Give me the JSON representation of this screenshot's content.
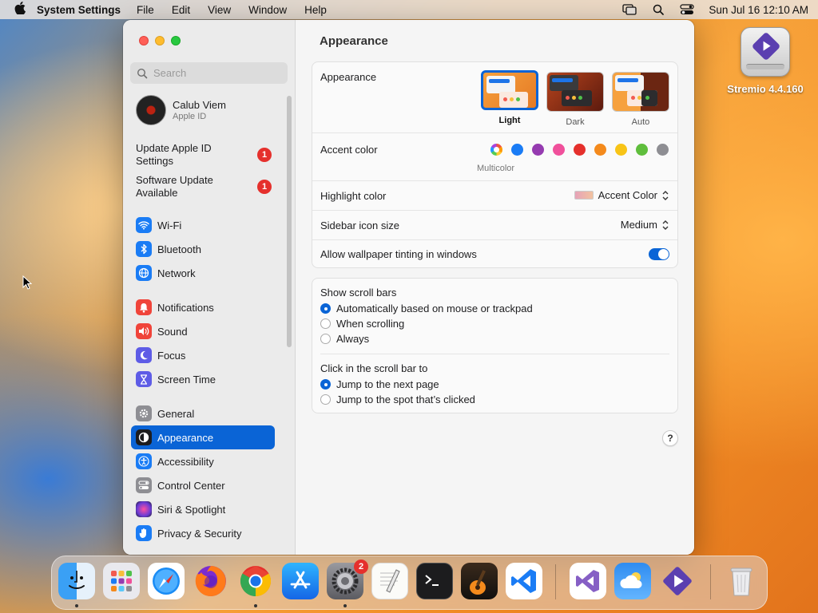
{
  "menubar": {
    "app_name": "System Settings",
    "menus": [
      "File",
      "Edit",
      "View",
      "Window",
      "Help"
    ],
    "datetime": "Sun Jul 16  12:10 AM"
  },
  "desktop": {
    "items": [
      {
        "label": "Stremio 4.4.160",
        "icon": "stremio-drive-icon"
      }
    ]
  },
  "window": {
    "sidebar": {
      "search_placeholder": "Search",
      "profile": {
        "name": "Calub Viem",
        "subtitle": "Apple ID"
      },
      "notices": [
        {
          "label": "Update Apple ID Settings",
          "badge": "1"
        },
        {
          "label": "Software Update Available",
          "badge": "1"
        }
      ],
      "groups": [
        [
          {
            "label": "Wi-Fi",
            "icon": "wifi-icon",
            "color": "#1a7cf5"
          },
          {
            "label": "Bluetooth",
            "icon": "bluetooth-icon",
            "color": "#1a7cf5"
          },
          {
            "label": "Network",
            "icon": "globe-icon",
            "color": "#1a7cf5"
          }
        ],
        [
          {
            "label": "Notifications",
            "icon": "bell-icon",
            "color": "#f0443a"
          },
          {
            "label": "Sound",
            "icon": "speaker-icon",
            "color": "#f0443a"
          },
          {
            "label": "Focus",
            "icon": "moon-icon",
            "color": "#5e5ce6"
          },
          {
            "label": "Screen Time",
            "icon": "hourglass-icon",
            "color": "#5e5ce6"
          }
        ],
        [
          {
            "label": "General",
            "icon": "gear-icon",
            "color": "#8e8e93"
          },
          {
            "label": "Appearance",
            "icon": "appearance-icon",
            "color": "#1c1c1e",
            "selected": true
          },
          {
            "label": "Accessibility",
            "icon": "accessibility-icon",
            "color": "#1a7cf5"
          },
          {
            "label": "Control Center",
            "icon": "control-center-icon",
            "color": "#8e8e93"
          },
          {
            "label": "Siri & Spotlight",
            "icon": "siri-icon",
            "color": "#b44ad6"
          },
          {
            "label": "Privacy & Security",
            "icon": "hand-icon",
            "color": "#1a7cf5"
          }
        ]
      ]
    },
    "main": {
      "title": "Appearance",
      "appearance": {
        "label": "Appearance",
        "options": [
          {
            "label": "Light",
            "selected": true
          },
          {
            "label": "Dark",
            "selected": false
          },
          {
            "label": "Auto",
            "selected": false
          }
        ]
      },
      "accent": {
        "label": "Accent color",
        "caption": "Multicolor",
        "colors": [
          "multicolor",
          "#1a7cf5",
          "#953bb0",
          "#f0509b",
          "#e5302c",
          "#f48a1c",
          "#f8c417",
          "#5fbe3c",
          "#8e8e93"
        ]
      },
      "highlight": {
        "label": "Highlight color",
        "value": "Accent Color"
      },
      "sidebar_icon_size": {
        "label": "Sidebar icon size",
        "value": "Medium"
      },
      "wallpaper_tinting": {
        "label": "Allow wallpaper tinting in windows",
        "on": true
      },
      "scroll_bars": {
        "title": "Show scroll bars",
        "options": [
          {
            "label": "Automatically based on mouse or trackpad",
            "selected": true
          },
          {
            "label": "When scrolling",
            "selected": false
          },
          {
            "label": "Always",
            "selected": false
          }
        ]
      },
      "click_scroll": {
        "title": "Click in the scroll bar to",
        "options": [
          {
            "label": "Jump to the next page",
            "selected": true
          },
          {
            "label": "Jump to the spot that’s clicked",
            "selected": false
          }
        ]
      },
      "help": "?"
    }
  },
  "dock": {
    "apps": [
      {
        "name": "finder-icon",
        "running": true
      },
      {
        "name": "launchpad-icon",
        "running": false
      },
      {
        "name": "safari-icon",
        "running": false
      },
      {
        "name": "firefox-icon",
        "running": false
      },
      {
        "name": "chrome-icon",
        "running": true
      },
      {
        "name": "app-store-icon",
        "running": false
      },
      {
        "name": "system-settings-icon",
        "running": true,
        "badge": "2"
      },
      {
        "name": "textedit-icon",
        "running": false
      },
      {
        "name": "terminal-icon",
        "running": false
      },
      {
        "name": "garageband-icon",
        "running": false
      },
      {
        "name": "vscode-icon",
        "running": false
      },
      {
        "name": "visual-studio-icon",
        "running": false
      },
      {
        "name": "weather-icon",
        "running": false
      },
      {
        "name": "stremio-icon",
        "running": false
      },
      {
        "name": "trash-icon",
        "running": false
      }
    ]
  }
}
